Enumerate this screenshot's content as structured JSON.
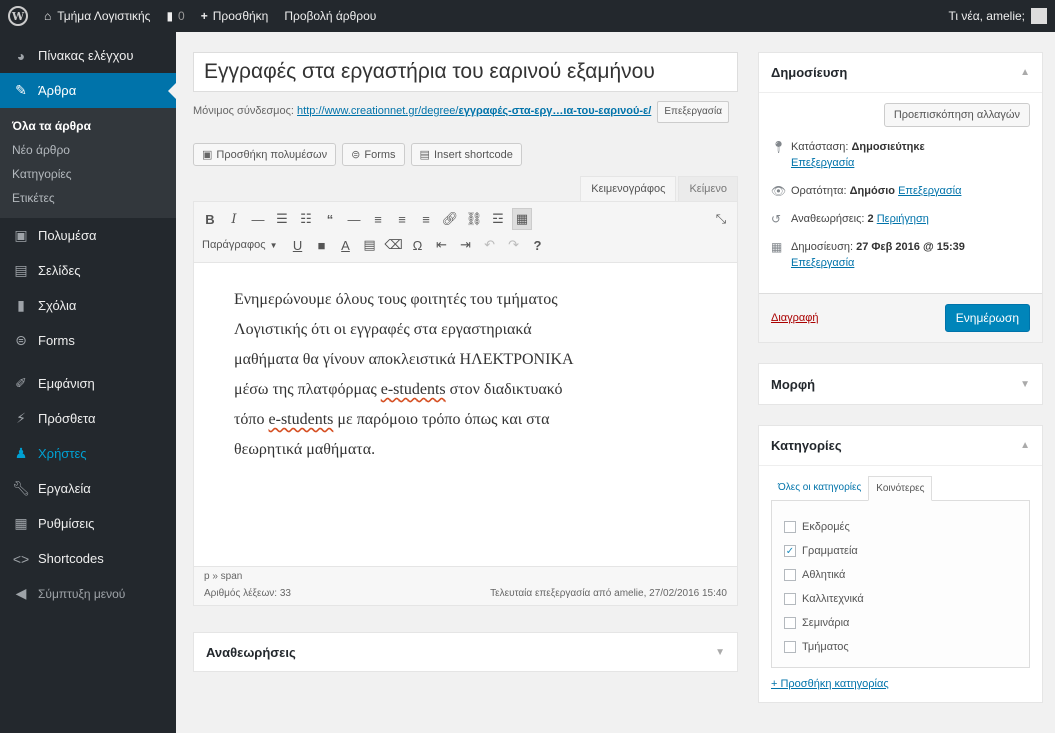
{
  "adminbar": {
    "site_name": "Τμήμα Λογιστικής",
    "comments_count": "0",
    "new_label": "Προσθήκη",
    "view_post": "Προβολή άρθρου",
    "greeting": "Τι νέα, amelie;"
  },
  "sidebar": {
    "items": [
      {
        "label": "Πίνακας ελέγχου",
        "icon": "dashboard-icon"
      },
      {
        "label": "Άρθρα",
        "icon": "pin-icon"
      },
      {
        "label": "Πολυμέσα",
        "icon": "media-icon"
      },
      {
        "label": "Σελίδες",
        "icon": "pages-icon"
      },
      {
        "label": "Σχόλια",
        "icon": "comments-icon"
      },
      {
        "label": "Forms",
        "icon": "forms-icon"
      },
      {
        "label": "Εμφάνιση",
        "icon": "appearance-icon"
      },
      {
        "label": "Πρόσθετα",
        "icon": "plugins-icon"
      },
      {
        "label": "Χρήστες",
        "icon": "users-icon"
      },
      {
        "label": "Εργαλεία",
        "icon": "tools-icon"
      },
      {
        "label": "Ρυθμίσεις",
        "icon": "settings-icon"
      },
      {
        "label": "Shortcodes",
        "icon": "shortcodes-icon"
      },
      {
        "label": "Σύμπτυξη μενού",
        "icon": "collapse-icon"
      }
    ],
    "posts_submenu": [
      "Όλα τα άρθρα",
      "Νέο άρθρο",
      "Κατηγορίες",
      "Ετικέτες"
    ]
  },
  "editor": {
    "title": "Εγγραφές στα εργαστήρια του εαρινού εξαμήνου",
    "permalink_label": "Μόνιμος σύνδεσμος:",
    "permalink_url_plain": "http://www.creationnet.gr/degree/",
    "permalink_url_slug": "εγγραφές-στα-εργ…ια-του-εαρινού-ε/",
    "edit_label": "Επεξεργασία",
    "media_buttons": [
      "Προσθήκη πολυμέσων",
      "Forms",
      "Insert shortcode"
    ],
    "tabs": [
      "Κειμενογράφος",
      "Κείμενο"
    ],
    "format_select": "Παράγραφος",
    "content_lines": [
      "Ενημερώνουμε όλους τους φοιτητές του τμήματος",
      "Λογιστικής ότι οι εγγραφές στα εργαστηριακά",
      "μαθήματα θα γίνουν αποκλειστικά ΗΛΕΚΤΡΟΝΙΚΑ"
    ],
    "content_line4_pre": "μέσω της πλατφόρμας ",
    "content_line4_word": "e-students",
    "content_line4_post": " στον διαδικτυακό",
    "content_line5_pre": "τόπο ",
    "content_line5_word": "e-students",
    "content_line5_post": " με παρόμοιο τρόπο όπως και στα",
    "content_line6": "θεωρητικά μαθήματα.",
    "path": "p » span",
    "word_count": "Αριθμός λέξεων: 33",
    "last_edit": "Τελευταία επεξεργασία από amelie, 27/02/2016 15:40",
    "revisions_box": "Αναθεωρήσεις"
  },
  "publish": {
    "title": "Δημοσίευση",
    "preview": "Προεπισκόπηση αλλαγών",
    "status_label": "Κατάσταση:",
    "status_value": "Δημοσιεύτηκε",
    "visibility_label": "Ορατότητα:",
    "visibility_value": "Δημόσιο",
    "revisions_label": "Αναθεωρήσεις:",
    "revisions_value": "2",
    "browse": "Περιήγηση",
    "published_label": "Δημοσίευση:",
    "published_value": "27 Φεβ 2016 @ 15:39",
    "edit": "Επεξεργασία",
    "delete": "Διαγραφή",
    "update": "Ενημέρωση"
  },
  "format_box": {
    "title": "Μορφή"
  },
  "categories": {
    "title": "Κατηγορίες",
    "tab_all": "Όλες οι κατηγορίες",
    "tab_common": "Κοινότερες",
    "items": [
      {
        "label": "Εκδρομές",
        "checked": false
      },
      {
        "label": "Γραμματεία",
        "checked": true
      },
      {
        "label": "Αθλητικά",
        "checked": false
      },
      {
        "label": "Καλλιτεχνικά",
        "checked": false
      },
      {
        "label": "Σεμινάρια",
        "checked": false
      },
      {
        "label": "Τμήματος",
        "checked": false
      }
    ],
    "add_new": "+ Προσθήκη κατηγορίας"
  },
  "colors": {
    "admin_dark": "#23282d",
    "accent_blue": "#0073aa",
    "primary_button": "#0085ba",
    "delete_red": "#a00"
  }
}
